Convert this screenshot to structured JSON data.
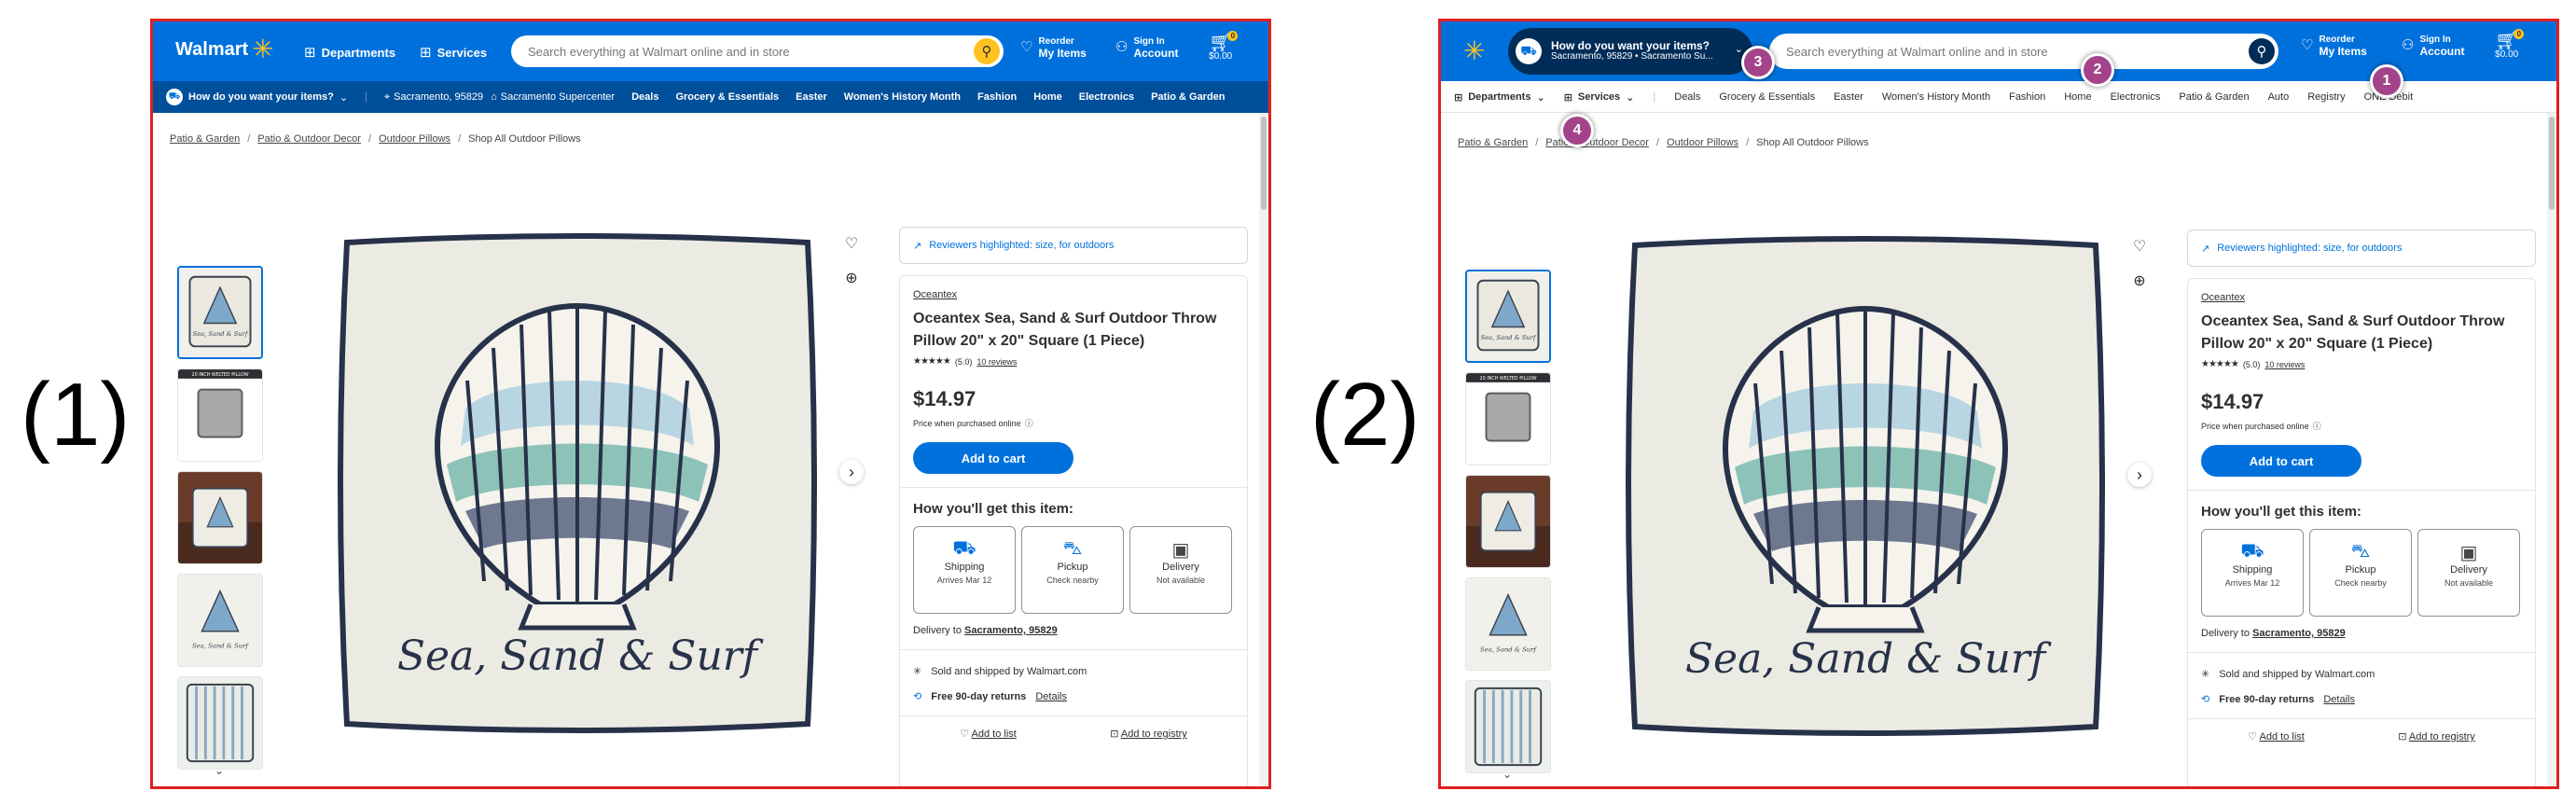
{
  "labels": [
    "(1)",
    "(2)"
  ],
  "header": {
    "logo_text": "Walmart",
    "departments": "Departments",
    "services": "Services",
    "search_placeholder": "Search everything at Walmart online and in store",
    "reorder_small": "Reorder",
    "reorder_big": "My Items",
    "signin_small": "Sign In",
    "signin_big": "Account",
    "cart_count": "0",
    "cart_total": "$0.00"
  },
  "nav1": {
    "how_label": "How do you want your items?",
    "zip": "Sacramento, 95829",
    "store": "Sacramento Supercenter",
    "links": [
      "Deals",
      "Grocery & Essentials",
      "Easter",
      "Women's History Month",
      "Fashion",
      "Home",
      "Electronics",
      "Patio & Garden"
    ]
  },
  "nav2": {
    "how_label": "How do you want your items?",
    "how_sub": "Sacramento, 95829 • Sacramento Su...",
    "departments": "Departments",
    "services": "Services",
    "links": [
      "Deals",
      "Grocery & Essentials",
      "Easter",
      "Women's History Month",
      "Fashion",
      "Home",
      "Electronics",
      "Patio & Garden",
      "Auto",
      "Registry",
      "ONE Debit"
    ]
  },
  "breadcrumb": [
    "Patio & Garden",
    "Patio & Outdoor Decor",
    "Outdoor Pillows",
    "Shop All Outdoor Pillows"
  ],
  "thumbs": {
    "second_label": "20 INCH WELTED PILLOW",
    "pillow_text": "Sea, Sand & Surf"
  },
  "product": {
    "reviewers": "Reviewers highlighted: size, for outdoors",
    "brand": "Oceantex",
    "title": "Oceantex Sea, Sand & Surf Outdoor Throw Pillow 20\" x 20\" Square (1 Piece)",
    "stars": "★★★★★",
    "rating": "(5.0)",
    "reviews": "10 reviews",
    "price": "$14.97",
    "price_sub": "Price when purchased online",
    "add_to_cart": "Add to cart",
    "how_get": "How you'll get this item:",
    "options": [
      {
        "name": "Shipping",
        "sub": "Arrives Mar 12",
        "icon": "truck-icon"
      },
      {
        "name": "Pickup",
        "sub": "Check nearby",
        "icon": "car-icon"
      },
      {
        "name": "Delivery",
        "sub": "Not available",
        "icon": "bag-icon"
      }
    ],
    "delivery_prefix": "Delivery to",
    "delivery_loc": "Sacramento, 95829",
    "seller": "Sold and shipped by Walmart.com",
    "returns": "Free 90-day returns",
    "details": "Details",
    "add_list": "Add to list",
    "add_registry": "Add to registry"
  },
  "markers": [
    "1",
    "2",
    "3",
    "4"
  ],
  "colors": {
    "walmart_blue": "#0071dc",
    "dark_blue": "#004f9a",
    "spark_yellow": "#ffc220",
    "marker_purple": "#a3448a",
    "frame_red": "#e02020"
  }
}
